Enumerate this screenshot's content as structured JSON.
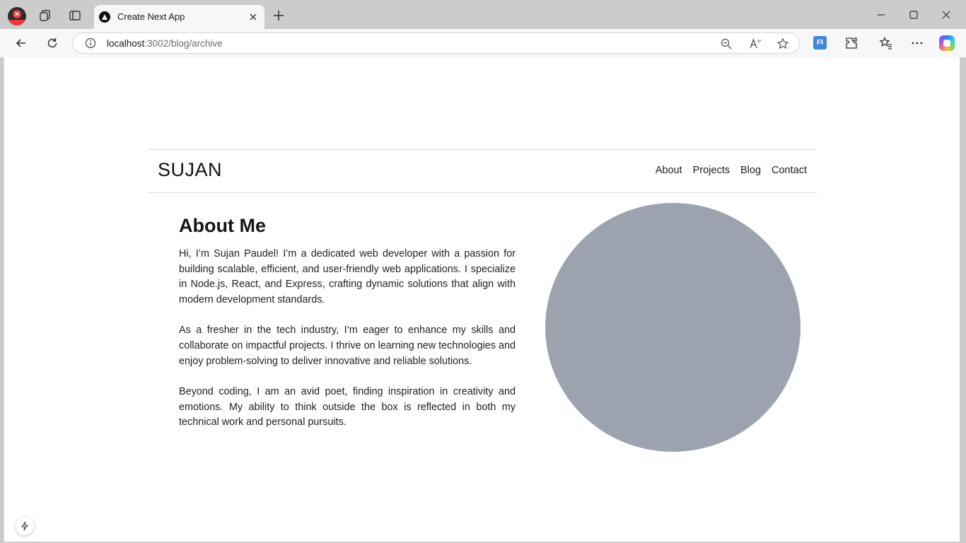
{
  "browser": {
    "tab": {
      "title": "Create Next App"
    },
    "address_bar": {
      "host": "localhost",
      "rest": ":3002/blog/archive"
    },
    "extension_badge": "FI"
  },
  "site": {
    "brand": "SUJAN",
    "nav": [
      "About",
      "Projects",
      "Blog",
      "Contact"
    ]
  },
  "about": {
    "heading": "About Me",
    "paragraphs": [
      "Hi, I’m Sujan Paudel! I’m a dedicated web developer with a passion for building scalable, efficient, and user-friendly web applications. I specialize in Node.js, React, and Express, crafting dynamic solutions that align with modern development standards.",
      "As a fresher in the tech industry, I’m eager to enhance my skills and collaborate on impactful projects. I thrive on learning new technologies and enjoy problem-solving to deliver innovative and reliable solutions.",
      "Beyond coding, I am an avid poet, finding inspiration in creativity and emotions. My ability to think outside the box is reflected in both my technical work and personal pursuits."
    ],
    "portrait_color": "#9ca3af"
  },
  "colors": {
    "tabstrip": "#cccccc",
    "toolbar": "#f7f7f7",
    "text": "#1f1f1f"
  }
}
